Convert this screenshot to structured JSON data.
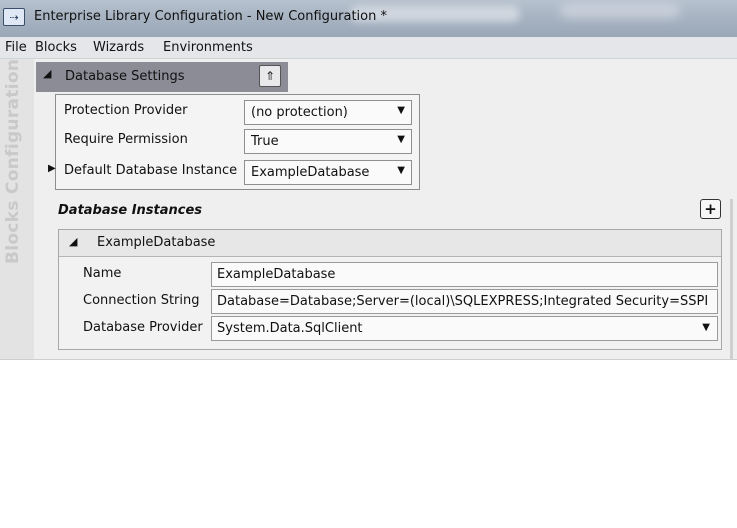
{
  "window": {
    "title": "Enterprise Library Configuration - New Configuration *",
    "app_icon": "⇢"
  },
  "menu": {
    "items": [
      "File",
      "Blocks",
      "Wizards",
      "Environments"
    ]
  },
  "sidebar": {
    "vertical_label": "Blocks Configuration"
  },
  "database_settings": {
    "header": "Database Settings",
    "collapse_icon": "⇑",
    "properties": [
      {
        "label": "Protection Provider",
        "value": "(no protection)"
      },
      {
        "label": "Require Permission",
        "value": "True"
      },
      {
        "label": "Default Database Instance",
        "value": "ExampleDatabase"
      }
    ]
  },
  "database_instances": {
    "title": "Database Instances",
    "add_icon": "+",
    "instance": {
      "header": "ExampleDatabase",
      "fields": [
        {
          "label": "Name",
          "value": "ExampleDatabase"
        },
        {
          "label": "Connection String",
          "value": "Database=Database;Server=(local)\\SQLEXPRESS;Integrated Security=SSPI"
        },
        {
          "label": "Database Provider",
          "value": "System.Data.SqlClient"
        }
      ]
    }
  },
  "glyphs": {
    "expanded_triangle": "◢",
    "selected_row": "▶",
    "dropdown": "▼"
  }
}
